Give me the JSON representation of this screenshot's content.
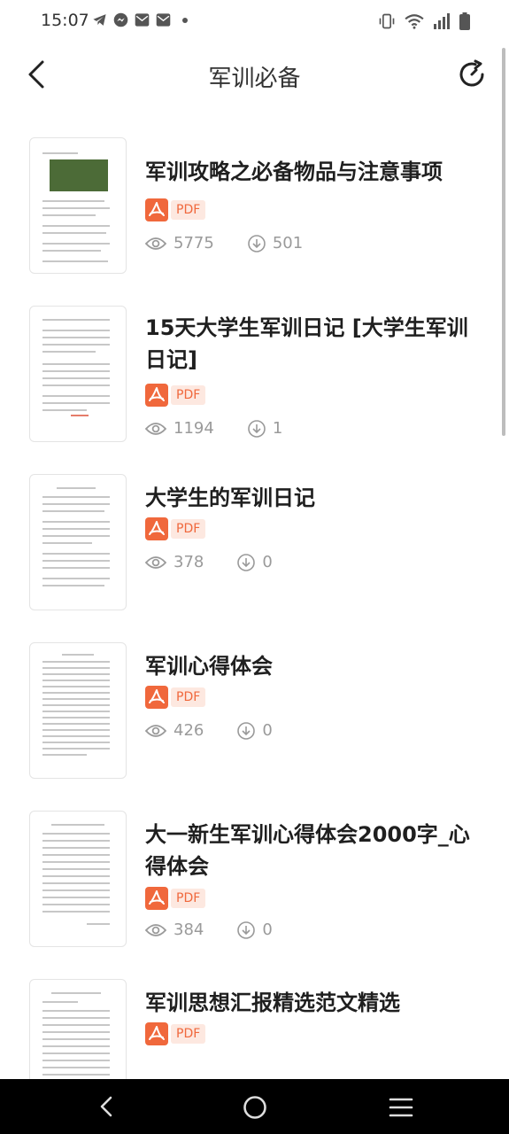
{
  "status_bar": {
    "time": "15:07",
    "left_icons": [
      "telegram-icon",
      "messenger-icon",
      "mail-icon",
      "mail-icon"
    ],
    "right_icons": [
      "vibrate-icon",
      "wifi-icon",
      "signal-icon",
      "battery-icon"
    ]
  },
  "header": {
    "title": "军训必备"
  },
  "documents": [
    {
      "title": "军训攻略之必备物品与注意事项",
      "type": "PDF",
      "views": "5775",
      "downloads": "501"
    },
    {
      "title": "15天大学生军训日记 [大学生军训日记]",
      "type": "PDF",
      "views": "1194",
      "downloads": "1"
    },
    {
      "title": "大学生的军训日记",
      "type": "PDF",
      "views": "378",
      "downloads": "0"
    },
    {
      "title": "军训心得体会",
      "type": "PDF",
      "views": "426",
      "downloads": "0"
    },
    {
      "title": "大一新生军训心得体会2000字_心得体会",
      "type": "PDF",
      "views": "384",
      "downloads": "0"
    },
    {
      "title": "军训思想汇报精选范文精选",
      "type": "PDF",
      "views": "",
      "downloads": ""
    }
  ],
  "colors": {
    "pdf_accent": "#f0683c",
    "pdf_tag_bg": "#fde8e0",
    "stat_text": "#9a9a9a"
  }
}
